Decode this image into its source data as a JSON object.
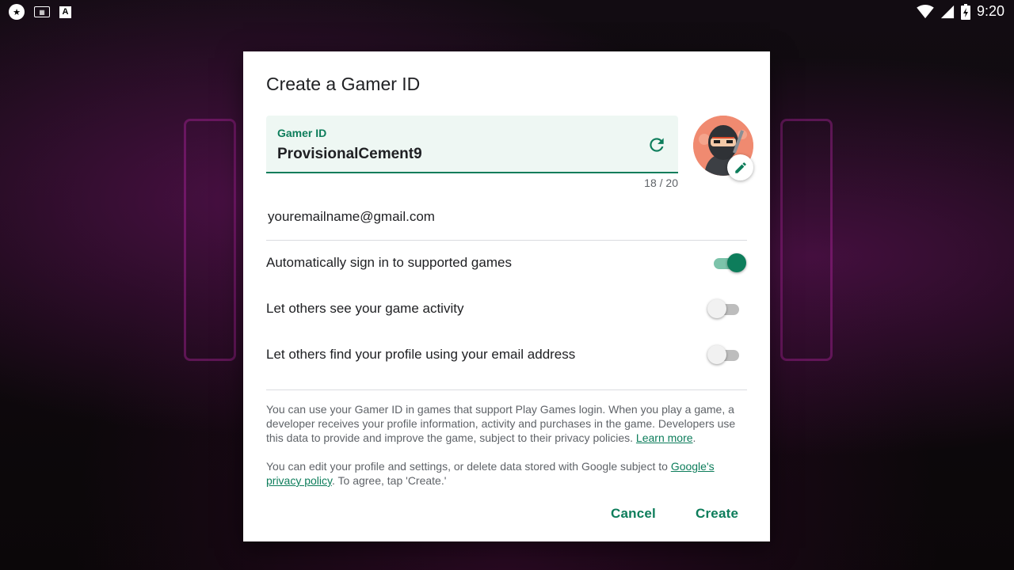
{
  "statusbar": {
    "time": "9:20"
  },
  "dialog": {
    "title": "Create a Gamer ID",
    "gamer_id": {
      "label": "Gamer ID",
      "value": "ProvisionalCement9",
      "char_count": "18 / 20"
    },
    "email": "youremailname@gmail.com",
    "settings": [
      {
        "label": "Automatically sign in to supported games",
        "on": true
      },
      {
        "label": "Let others see your game activity",
        "on": false
      },
      {
        "label": "Let others find your profile using your email address",
        "on": false
      }
    ],
    "info1": {
      "text": "You can use your Gamer ID in games that support Play Games login. When you play a game, a developer receives your profile information, activity and purchases in the game. Developers use this data to provide and improve the game, subject to their privacy policies. ",
      "link": "Learn more",
      "after": "."
    },
    "info2": {
      "text": "You can edit your profile and settings, or delete data stored with Google subject to ",
      "link": "Google's privacy policy",
      "after": ". To agree, tap 'Create.'"
    },
    "cancel_label": "Cancel",
    "create_label": "Create"
  },
  "colors": {
    "accent": "#0d7d5b",
    "field_bg": "#eef7f3",
    "text": "#202124",
    "secondary_text": "#5f6368"
  },
  "icons": [
    "refresh-icon",
    "edit-pencil-icon",
    "wifi-icon",
    "signal-icon",
    "battery-icon",
    "keyboard-icon"
  ]
}
